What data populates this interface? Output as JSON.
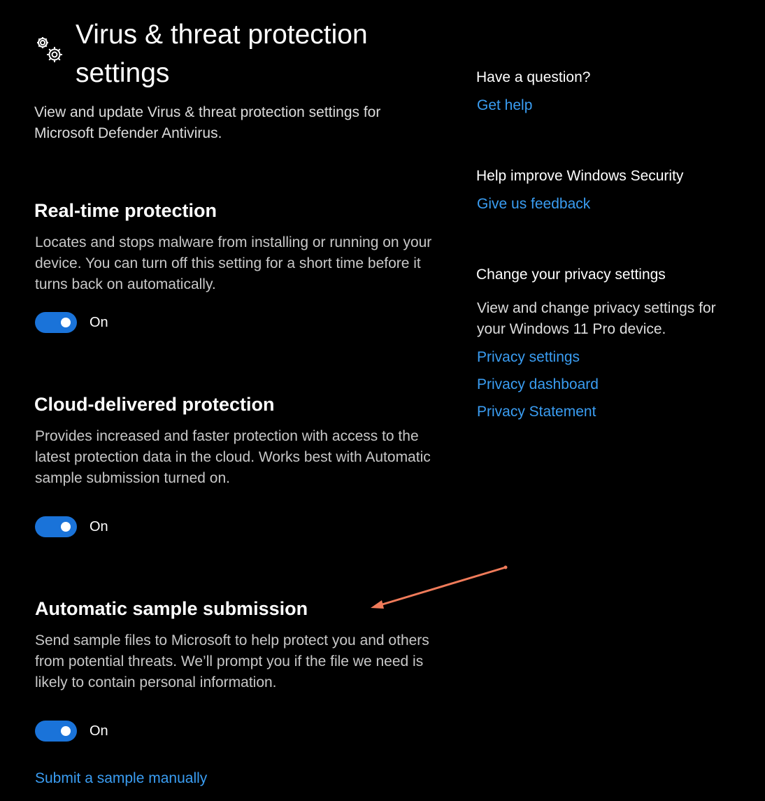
{
  "header": {
    "title": "Virus & threat protection settings",
    "description": "View and update Virus & threat protection settings for Microsoft Defender Antivirus.",
    "icon": "gears-icon"
  },
  "sections": [
    {
      "heading": "Real-time protection",
      "description": "Locates and stops malware from installing or running on your device. You can turn off this setting for a short time before it turns back on automatically.",
      "toggle_state": "On",
      "toggle_on": true
    },
    {
      "heading": "Cloud-delivered protection",
      "description": "Provides increased and faster protection with access to the latest protection data in the cloud. Works best with Automatic sample submission turned on.",
      "toggle_state": "On",
      "toggle_on": true
    },
    {
      "heading": "Automatic sample submission",
      "description": "Send sample files to Microsoft to help protect you and others from potential threats. We’ll prompt you if the file we need is likely to contain personal information.",
      "toggle_state": "On",
      "toggle_on": true,
      "link": "Submit a sample manually"
    }
  ],
  "sidebar": {
    "question": {
      "heading": "Have a question?",
      "link": "Get help"
    },
    "improve": {
      "heading": "Help improve Windows Security",
      "link": "Give us feedback"
    },
    "privacy": {
      "heading": "Change your privacy settings",
      "description": "View and change privacy settings for your Windows 11 Pro device.",
      "links": [
        "Privacy settings",
        "Privacy dashboard",
        "Privacy Statement"
      ]
    }
  },
  "colors": {
    "background": "#000000",
    "accent": "#1a73d9",
    "link": "#3a9df2",
    "annotation": "#f07b5a"
  }
}
